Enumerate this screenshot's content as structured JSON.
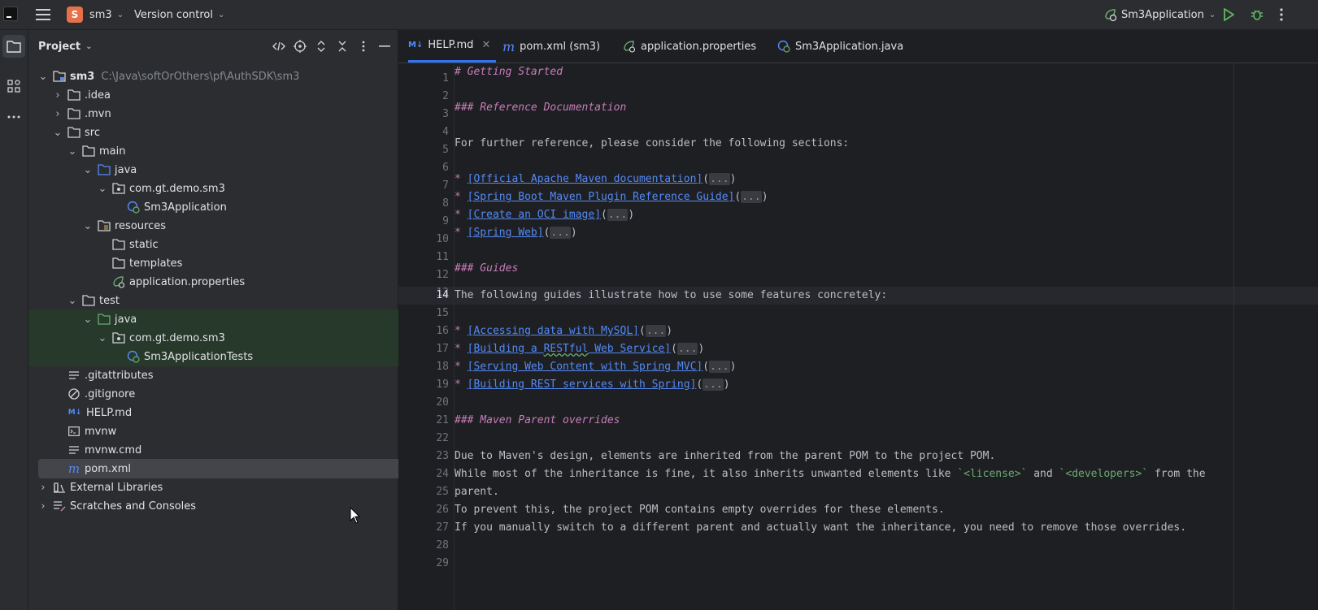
{
  "topbar": {
    "project_badge": "S",
    "project_name": "sm3",
    "vcs": "Version control",
    "run_config": "Sm3Application"
  },
  "project_panel": {
    "title": "Project",
    "tree": [
      {
        "label": "sm3",
        "path": "C:\\Java\\softOrOthers\\pf\\AuthSDK\\sm3"
      },
      {
        "label": ".idea"
      },
      {
        "label": ".mvn"
      },
      {
        "label": "src"
      },
      {
        "label": "main"
      },
      {
        "label": "java"
      },
      {
        "label": "com.gt.demo.sm3"
      },
      {
        "label": "Sm3Application"
      },
      {
        "label": "resources"
      },
      {
        "label": "static"
      },
      {
        "label": "templates"
      },
      {
        "label": "application.properties"
      },
      {
        "label": "test"
      },
      {
        "label": "java"
      },
      {
        "label": "com.gt.demo.sm3"
      },
      {
        "label": "Sm3ApplicationTests"
      },
      {
        "label": ".gitattributes"
      },
      {
        "label": ".gitignore"
      },
      {
        "label": "HELP.md"
      },
      {
        "label": "mvnw"
      },
      {
        "label": "mvnw.cmd"
      },
      {
        "label": "pom.xml"
      },
      {
        "label": "External Libraries"
      },
      {
        "label": "Scratches and Consoles"
      }
    ]
  },
  "tabs": [
    {
      "badge": "M↓",
      "label": "HELP.md"
    },
    {
      "badge": "m",
      "label": "pom.xml (sm3)"
    },
    {
      "label": "application.properties"
    },
    {
      "label": "Sm3Application.java"
    }
  ],
  "editor": {
    "current_line": "14",
    "line_numbers": [
      "1",
      "2",
      "3",
      "4",
      "5",
      "6",
      "7",
      "8",
      "9",
      "10",
      "11",
      "12",
      "13",
      "14",
      "15",
      "16",
      "17",
      "18",
      "19",
      "20",
      "21",
      "22",
      "23",
      "24",
      "25",
      "26",
      "27",
      "28",
      "29"
    ],
    "text": {
      "l1": "# Getting Started",
      "l3": "### Reference Documentation",
      "l5": "For further reference, please consider the following sections:",
      "l7": "[Official Apache Maven documentation]",
      "l8": "[Spring Boot Maven Plugin Reference Guide]",
      "l9": "[Create an OCI image]",
      "l10": "[Spring Web]",
      "l12": "### Guides",
      "l14": "The following guides illustrate how to use some features concretely:",
      "l16": "[Accessing data with MySQL]",
      "l17a": "[Building a ",
      "l17b": "RESTful",
      "l17c": " Web Service]",
      "l18": "[Serving Web Content with Spring MVC]",
      "l19": "[Building REST services with Spring]",
      "l21": "### Maven Parent overrides",
      "l23": "Due to Maven's design, elements are inherited from the parent POM to the project POM.",
      "l24a": "While most of the inheritance is fine, it also inherits unwanted elements like ",
      "l24b": "`<license>`",
      "l24c": " and ",
      "l24d": "`<developers>`",
      "l24e": " from the",
      "l25": "parent.",
      "l26": "To prevent this, the project POM contains empty overrides for these elements.",
      "l27": "If you manually switch to a different parent and actually want the inheritance, you need to remove those overrides.",
      "bullet": "* ",
      "fold": "...",
      "lparen": "(",
      "rparen": ")"
    }
  }
}
